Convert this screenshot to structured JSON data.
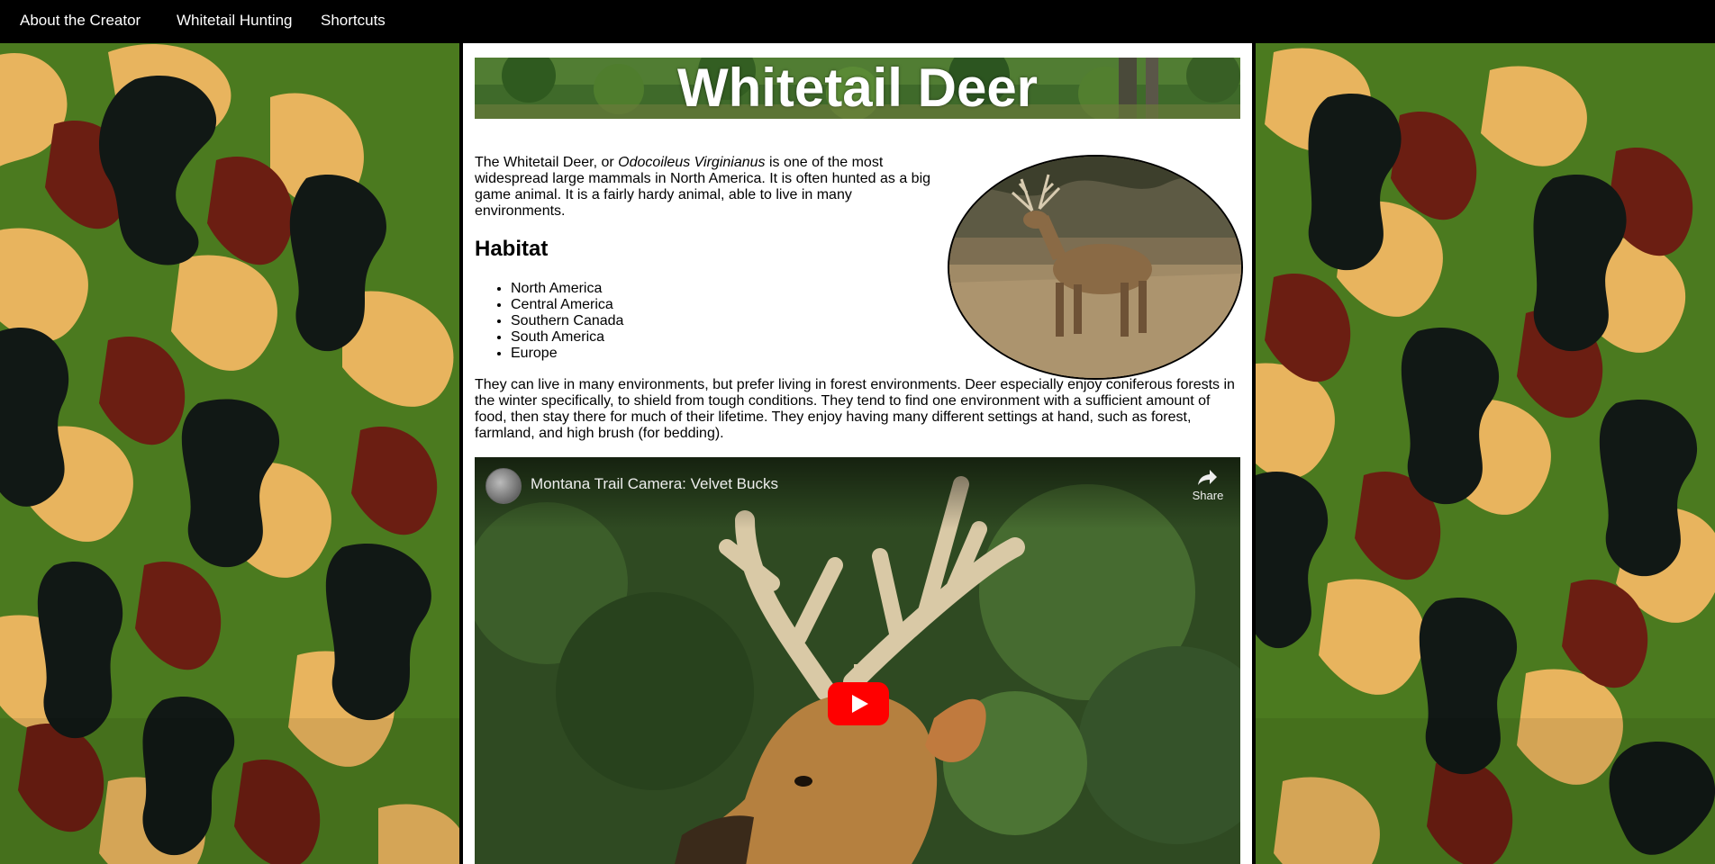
{
  "nav": {
    "items": [
      {
        "label": "About the Creator"
      },
      {
        "label": "Whitetail Hunting"
      },
      {
        "label": "Shortcuts"
      }
    ]
  },
  "header": {
    "title": "Whitetail Deer"
  },
  "intro": {
    "text_before": "The Whitetail Deer, or ",
    "scientific_name": "Odocoileus Virginianus",
    "text_after": " is one of the most widespread large mammals in North America. It is often hunted as a big game animal. It is a fairly hardy animal, able to live in many environments."
  },
  "habitat": {
    "heading": "Habitat",
    "regions": [
      "North America",
      "Central America",
      "Southern Canada",
      "South America",
      "Europe"
    ],
    "description": "They can live in many environments, but prefer living in forest environments. Deer especially enjoy coniferous forests in the winter specifically, to shield from tough conditions. They tend to find one environment with a sufficient amount of food, then stay there for much of their lifetime. They enjoy having many different settings at hand, such as forest, farmland, and high brush (for bedding)."
  },
  "video": {
    "title": "Montana Trail Camera: Velvet Bucks",
    "share_label": "Share"
  },
  "colors": {
    "camo_green": "#4b7a1f",
    "camo_tan": "#e8b45e",
    "camo_brown": "#6b1e12",
    "camo_black": "#111815",
    "youtube_red": "#ff0000"
  }
}
